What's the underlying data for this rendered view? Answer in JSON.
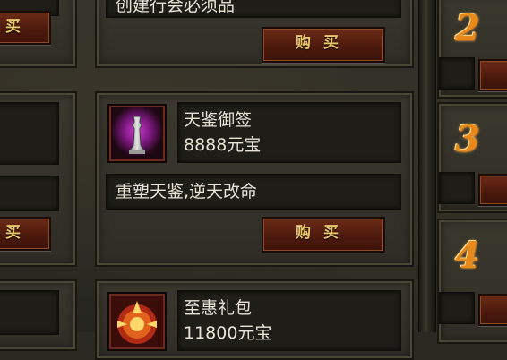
{
  "shop": {
    "items": [
      {
        "name": "",
        "price": "",
        "description": "创建行会必须品",
        "buy_label": "购买"
      },
      {
        "name": "天鉴御签",
        "price": "8888元宝",
        "description": "重塑天鉴,逆天改命",
        "buy_label": "购买"
      },
      {
        "name": "至惠礼包",
        "price": "11800元宝",
        "description": ""
      }
    ],
    "left_column": {
      "buy_label_top": "买",
      "buy_label_mid": "买"
    }
  },
  "ranking": {
    "ranks": [
      "2",
      "3",
      "4"
    ]
  },
  "colors": {
    "button_text": "#e9c66a",
    "button_bg": "#5a2210",
    "rank_number": "#e78a1b",
    "item_text": "#e8e3d6"
  }
}
